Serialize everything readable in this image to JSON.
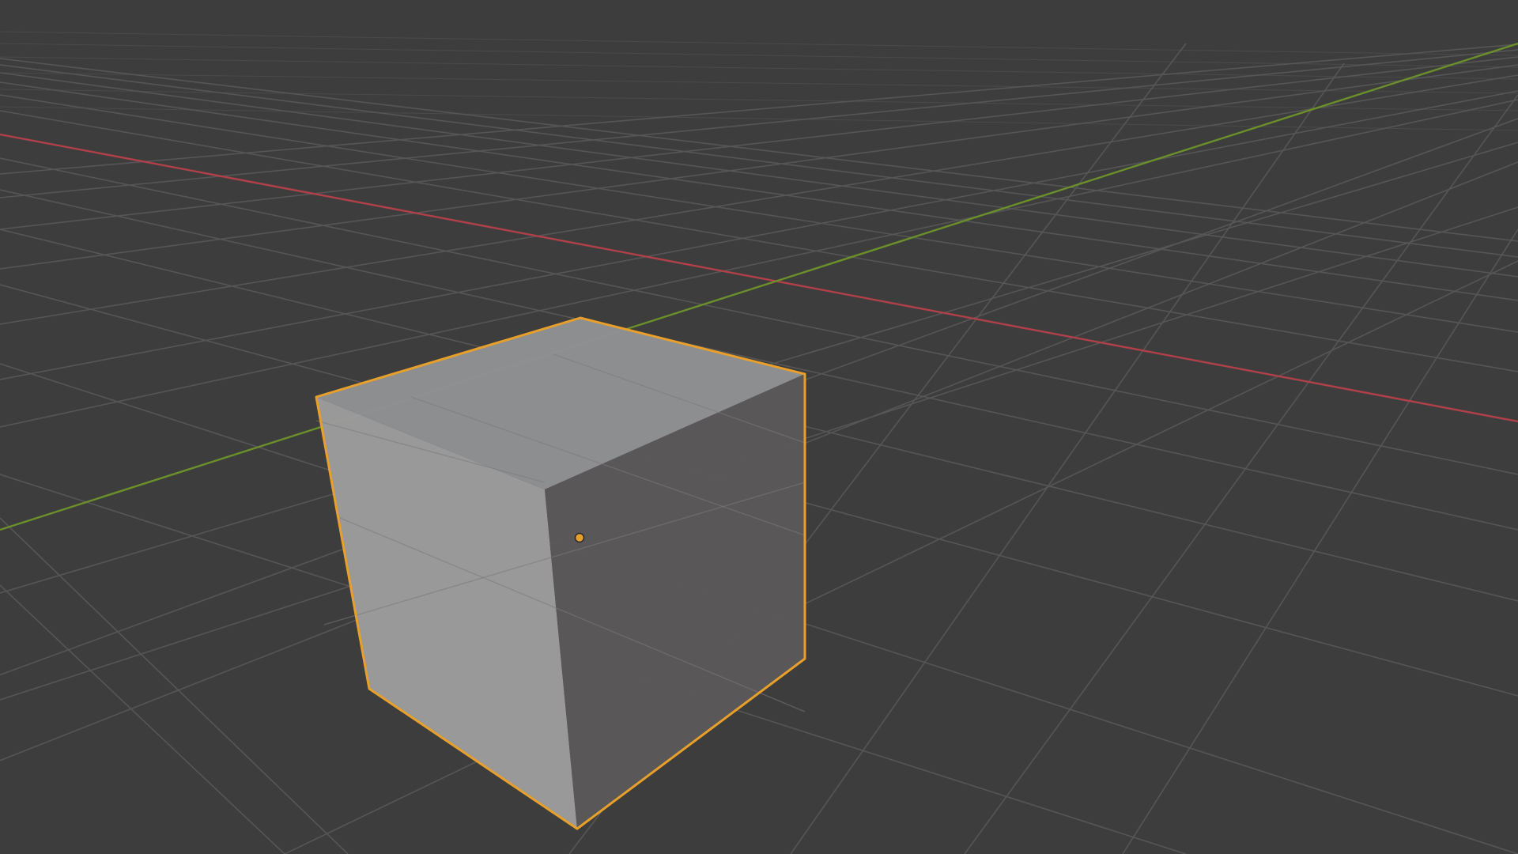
{
  "viewport": {
    "background": "#3d3d3d",
    "grid_color": "#565656",
    "x_axis_color": "#b04049",
    "y_axis_color": "#6b8f2a"
  },
  "selected_object": {
    "type": "cube",
    "outline_color": "#e8a02a",
    "face_colors": {
      "top": "#8f9193",
      "left": "#9c9c9c",
      "right": "#5a5859"
    },
    "origin_marker_color": "#e8a02a"
  }
}
